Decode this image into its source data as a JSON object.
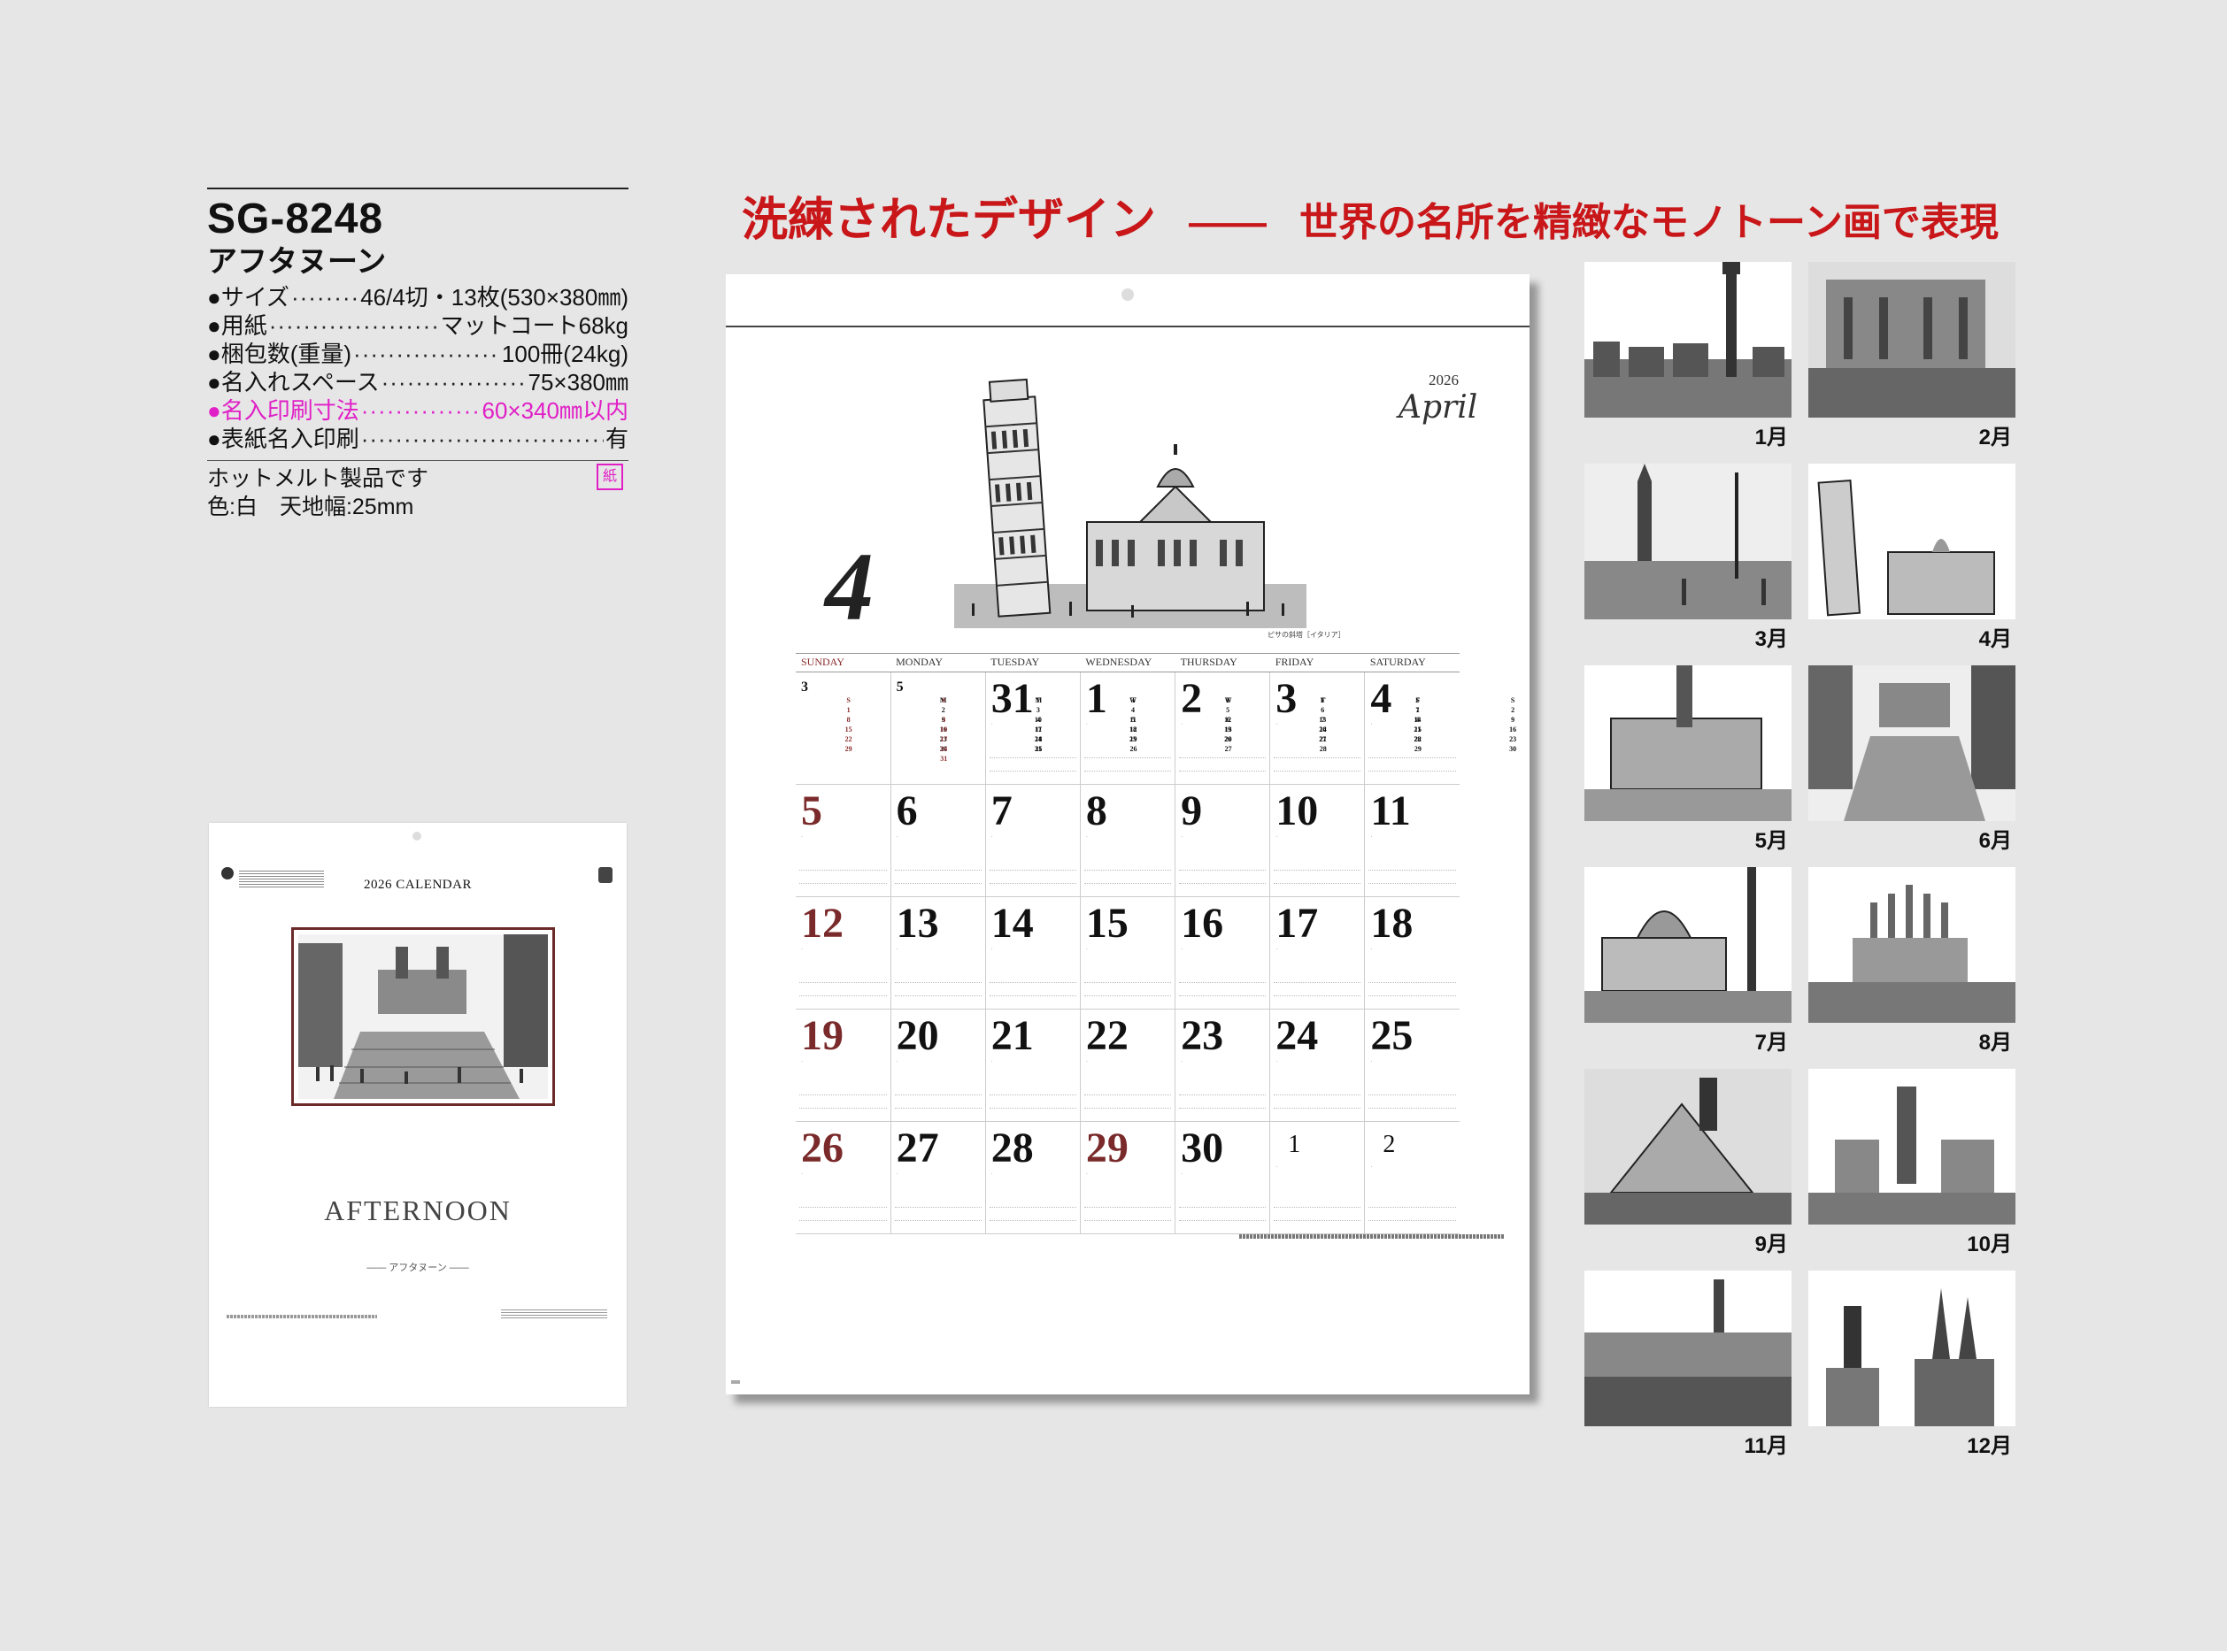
{
  "headline": {
    "main": "洗練されたデザイン",
    "dash": "——",
    "sub": "世界の名所を精緻なモノトーン画で表現"
  },
  "product": {
    "model": "SG-8248",
    "name": "アフタヌーン",
    "specs": [
      {
        "k": "●サイズ",
        "v": "46/4切・13枚(530×380㎜)"
      },
      {
        "k": "●用紙",
        "v": "マットコート68kg"
      },
      {
        "k": "●梱包数(重量)",
        "v": "100冊(24kg)"
      },
      {
        "k": "●名入れスペース",
        "v": "75×380㎜"
      },
      {
        "k": "●名入印刷寸法",
        "v": "60×340㎜以内"
      },
      {
        "k": "●表紙名入印刷",
        "v": "有"
      }
    ],
    "note1": "ホットメルト製品です",
    "note2": "色:白　天地幅:25mm",
    "stamp": "紙"
  },
  "cover": {
    "calendar_title": "2026 CALENDAR",
    "title": "AFTERNOON",
    "subtitle": "—— アフタヌーン ——"
  },
  "sheet": {
    "year": "2026",
    "month_name": "April",
    "month_number": "4",
    "caption": "ピサの斜塔［イタリア］",
    "weekdays": [
      "SUNDAY",
      "MONDAY",
      "TUESDAY",
      "WEDNESDAY",
      "THURSDAY",
      "FRIDAY",
      "SATURDAY"
    ],
    "mini_prev": {
      "month": "3",
      "head": [
        "S",
        "M",
        "T",
        "W",
        "T",
        "F",
        "S"
      ],
      "rows": [
        [
          "1",
          "2",
          "3",
          "4",
          "5",
          "6",
          "7"
        ],
        [
          "8",
          "9",
          "10",
          "11",
          "12",
          "13",
          "14"
        ],
        [
          "15",
          "16",
          "17",
          "18",
          "19",
          "20",
          "21"
        ],
        [
          "22",
          "23",
          "24",
          "25",
          "26",
          "27",
          "28"
        ],
        [
          "29",
          "30",
          "31",
          "",
          "",
          "",
          ""
        ]
      ]
    },
    "mini_next": {
      "month": "5",
      "head": [
        "S",
        "M",
        "T",
        "W",
        "T",
        "F",
        "S"
      ],
      "rows": [
        [
          "",
          "",
          "",
          "",
          "",
          "1",
          "2"
        ],
        [
          "3",
          "4",
          "5",
          "6",
          "7",
          "8",
          "9"
        ],
        [
          "10",
          "11",
          "12",
          "13",
          "14",
          "15",
          "16"
        ],
        [
          "17",
          "18",
          "19",
          "20",
          "21",
          "22",
          "23"
        ],
        [
          "24",
          "25",
          "26",
          "27",
          "28",
          "29",
          "30"
        ],
        [
          "31",
          "",
          "",
          "",
          "",
          "",
          ""
        ]
      ]
    },
    "weeks": [
      [
        "",
        "",
        "31",
        "1",
        "2",
        "3",
        "4"
      ],
      [
        "5",
        "6",
        "7",
        "8",
        "9",
        "10",
        "11"
      ],
      [
        "12",
        "13",
        "14",
        "15",
        "16",
        "17",
        "18"
      ],
      [
        "19",
        "20",
        "21",
        "22",
        "23",
        "24",
        "25"
      ],
      [
        "26",
        "27",
        "28",
        "29",
        "30",
        "1",
        "2"
      ]
    ]
  },
  "months": [
    {
      "label": "1月"
    },
    {
      "label": "2月"
    },
    {
      "label": "3月"
    },
    {
      "label": "4月"
    },
    {
      "label": "5月"
    },
    {
      "label": "6月"
    },
    {
      "label": "7月"
    },
    {
      "label": "8月"
    },
    {
      "label": "9月"
    },
    {
      "label": "10月"
    },
    {
      "label": "11月"
    },
    {
      "label": "12月"
    }
  ],
  "colors": {
    "headline": "#c81619",
    "highlight": "#e01fc6",
    "sunday": "#7a2a2a"
  }
}
